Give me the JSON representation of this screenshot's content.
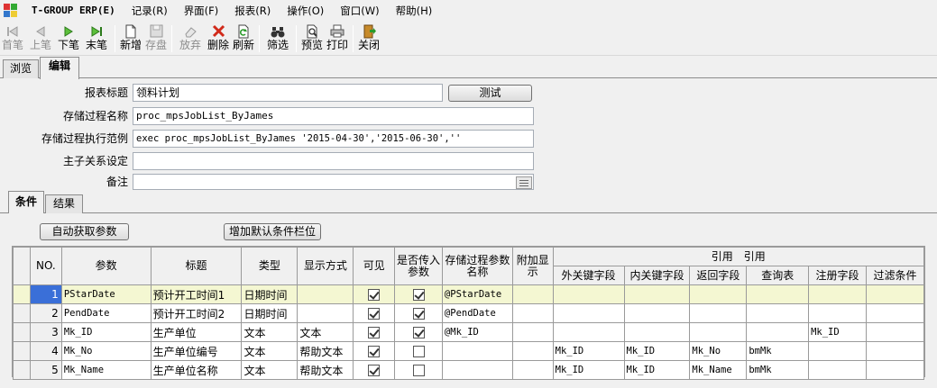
{
  "menu": [
    "T-GROUP ERP(E)",
    "记录(R)",
    "界面(F)",
    "报表(R)",
    "操作(O)",
    "窗口(W)",
    "帮助(H)"
  ],
  "toolbar": {
    "first": "首笔",
    "prev": "上笔",
    "next": "下笔",
    "last": "末笔",
    "new": "新增",
    "save": "存盘",
    "discard": "放弃",
    "delete": "删除",
    "refresh": "刷新",
    "filter": "筛选",
    "preview": "预览",
    "print": "打印",
    "close": "关闭"
  },
  "tabs": [
    "浏览",
    "编辑"
  ],
  "form": {
    "title_label": "报表标题",
    "title_value": "领料计划",
    "test_button": "测试",
    "proc_label": "存储过程名称",
    "proc_value": "proc_mpsJobList_ByJames",
    "example_label": "存储过程执行范例",
    "example_value": "exec proc_mpsJobList_ByJames '2015-04-30','2015-06-30',''",
    "master_label": "主子关系设定",
    "master_value": "",
    "remark_label": "备注",
    "remark_value": ""
  },
  "subtabs": [
    "条件",
    "结果"
  ],
  "buttons": {
    "auto_params": "自动获取参数",
    "add_default": "增加默认条件栏位"
  },
  "grid": {
    "headers": {
      "no": "NO.",
      "param": "参数",
      "title": "标题",
      "type": "类型",
      "display": "显示方式",
      "visible": "可见",
      "pass": "是否传入参数",
      "proc_param": "存储过程参数名称",
      "extra": "附加显示",
      "ref_group": "引用　引用",
      "fk": "外关键字段",
      "ik": "内关键字段",
      "ret": "返回字段",
      "query": "查询表",
      "reg": "注册字段",
      "filter": "过滤条件"
    },
    "rows": [
      {
        "no": "1",
        "param": "PStarDate",
        "title": "预计开工时间1",
        "type": "日期时间",
        "display": "",
        "visible": true,
        "pass": true,
        "proc_param": "@PStarDate",
        "extra": "",
        "fk": "",
        "ik": "",
        "ret": "",
        "query": "",
        "reg": "",
        "filter": ""
      },
      {
        "no": "2",
        "param": "PendDate",
        "title": "预计开工时间2",
        "type": "日期时间",
        "display": "",
        "visible": true,
        "pass": true,
        "proc_param": "@PendDate",
        "extra": "",
        "fk": "",
        "ik": "",
        "ret": "",
        "query": "",
        "reg": "",
        "filter": ""
      },
      {
        "no": "3",
        "param": "Mk_ID",
        "title": "生产单位",
        "type": "文本",
        "display": "文本",
        "visible": true,
        "pass": true,
        "proc_param": "@Mk_ID",
        "extra": "",
        "fk": "",
        "ik": "",
        "ret": "",
        "query": "",
        "reg": "Mk_ID",
        "filter": ""
      },
      {
        "no": "4",
        "param": "Mk_No",
        "title": "生产单位编号",
        "type": "文本",
        "display": "帮助文本",
        "visible": true,
        "pass": false,
        "proc_param": "",
        "extra": "",
        "fk": "Mk_ID",
        "ik": "Mk_ID",
        "ret": "Mk_No",
        "query": "bmMk",
        "reg": "",
        "filter": ""
      },
      {
        "no": "5",
        "param": "Mk_Name",
        "title": "生产单位名称",
        "type": "文本",
        "display": "帮助文本",
        "visible": true,
        "pass": false,
        "proc_param": "",
        "extra": "",
        "fk": "Mk_ID",
        "ik": "Mk_ID",
        "ret": "Mk_Name",
        "query": "bmMk",
        "reg": "",
        "filter": ""
      }
    ]
  }
}
